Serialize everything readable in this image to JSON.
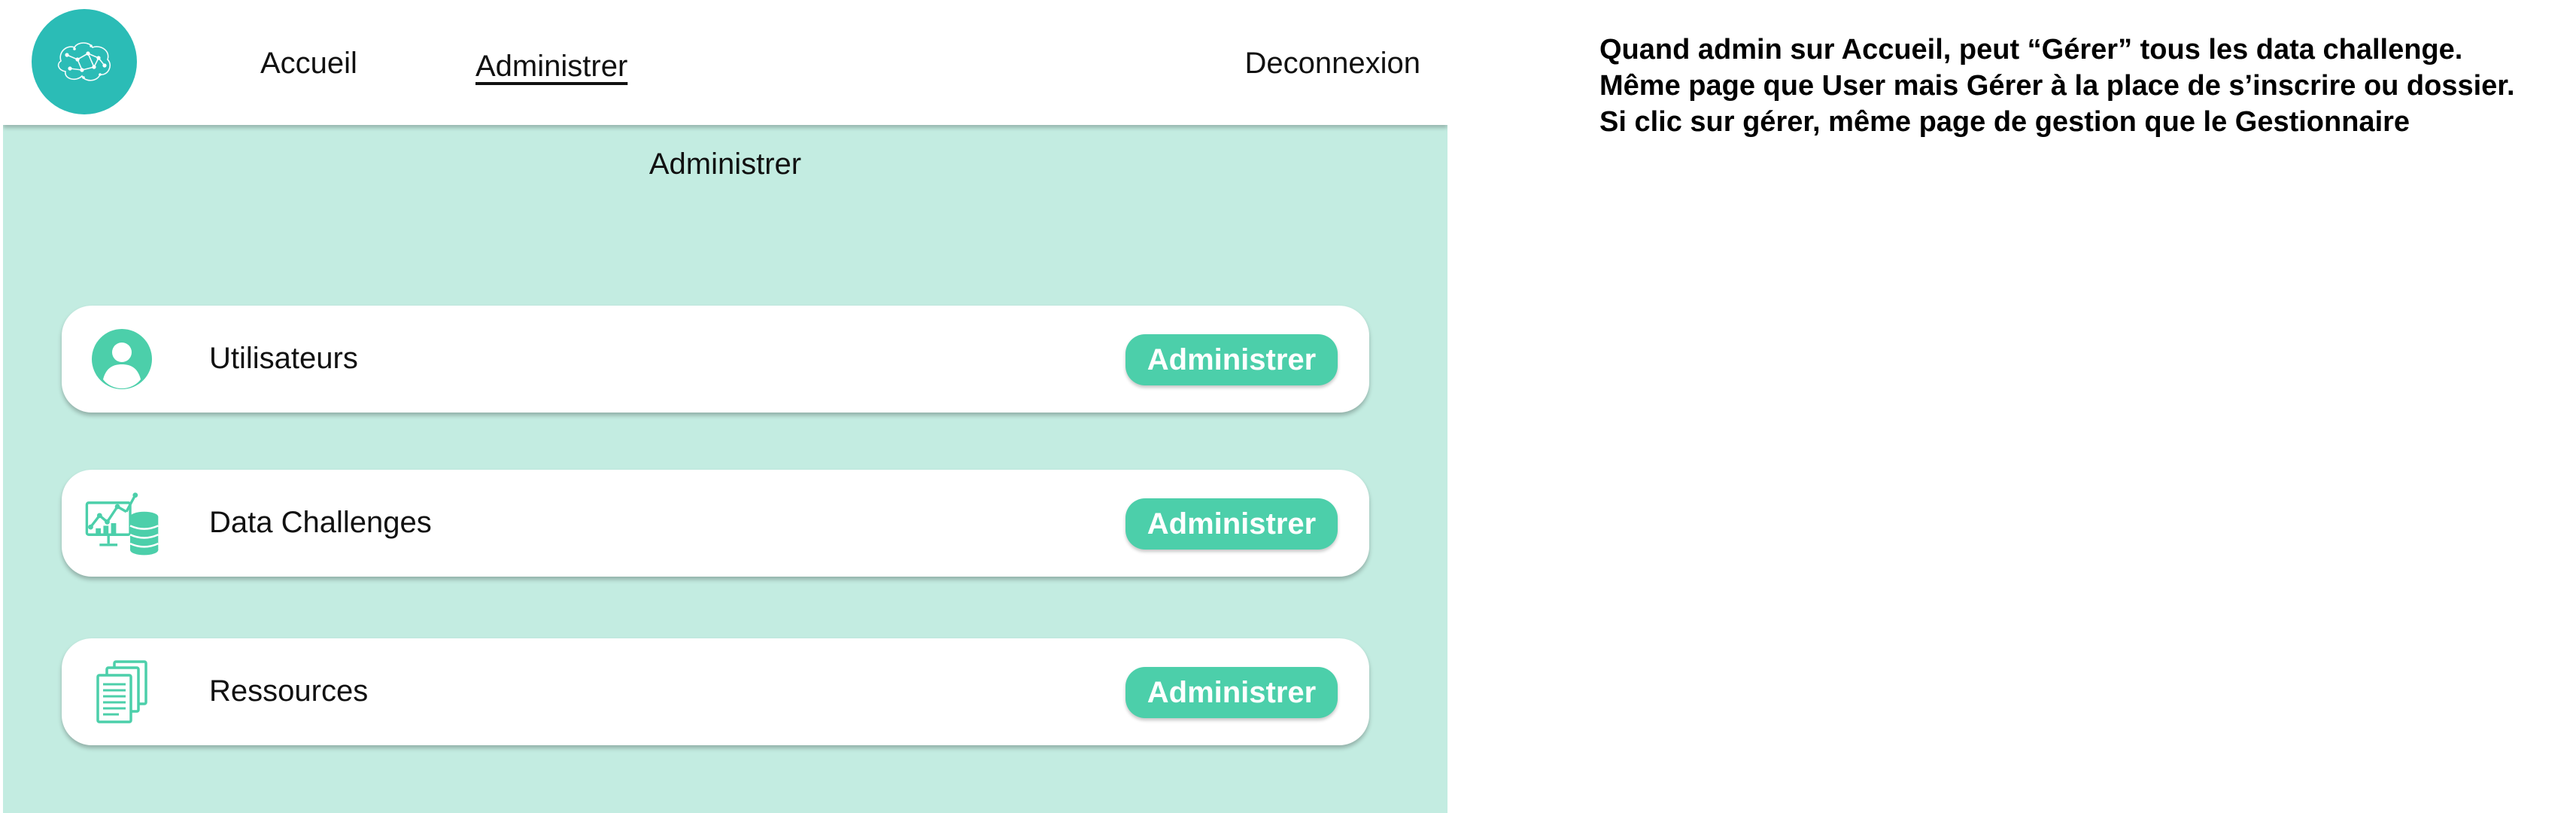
{
  "navbar": {
    "logo_icon": "brain-network-icon",
    "home_label": "Accueil",
    "admin_label": "Administrer",
    "logout_label": "Deconnexion"
  },
  "page": {
    "title": "Administrer"
  },
  "cards": [
    {
      "label": "Utilisateurs",
      "icon": "user-icon",
      "button_label": "Administrer"
    },
    {
      "label": "Data Challenges",
      "icon": "data-analytics-icon",
      "button_label": "Administrer"
    },
    {
      "label": "Ressources",
      "icon": "documents-icon",
      "button_label": "Administrer"
    }
  ],
  "note": {
    "lines": [
      "Quand admin sur Accueil, peut “Gérer” tous les data challenge.",
      "Même page que User mais Gérer à la place de s’inscrire ou dossier.",
      "Si clic sur gérer, même page de gestion que le Gestionnaire"
    ]
  },
  "colors": {
    "background": "#c3ece1",
    "logo": "#2bbcb6",
    "accent": "#4ccfaa",
    "card": "#ffffff"
  }
}
